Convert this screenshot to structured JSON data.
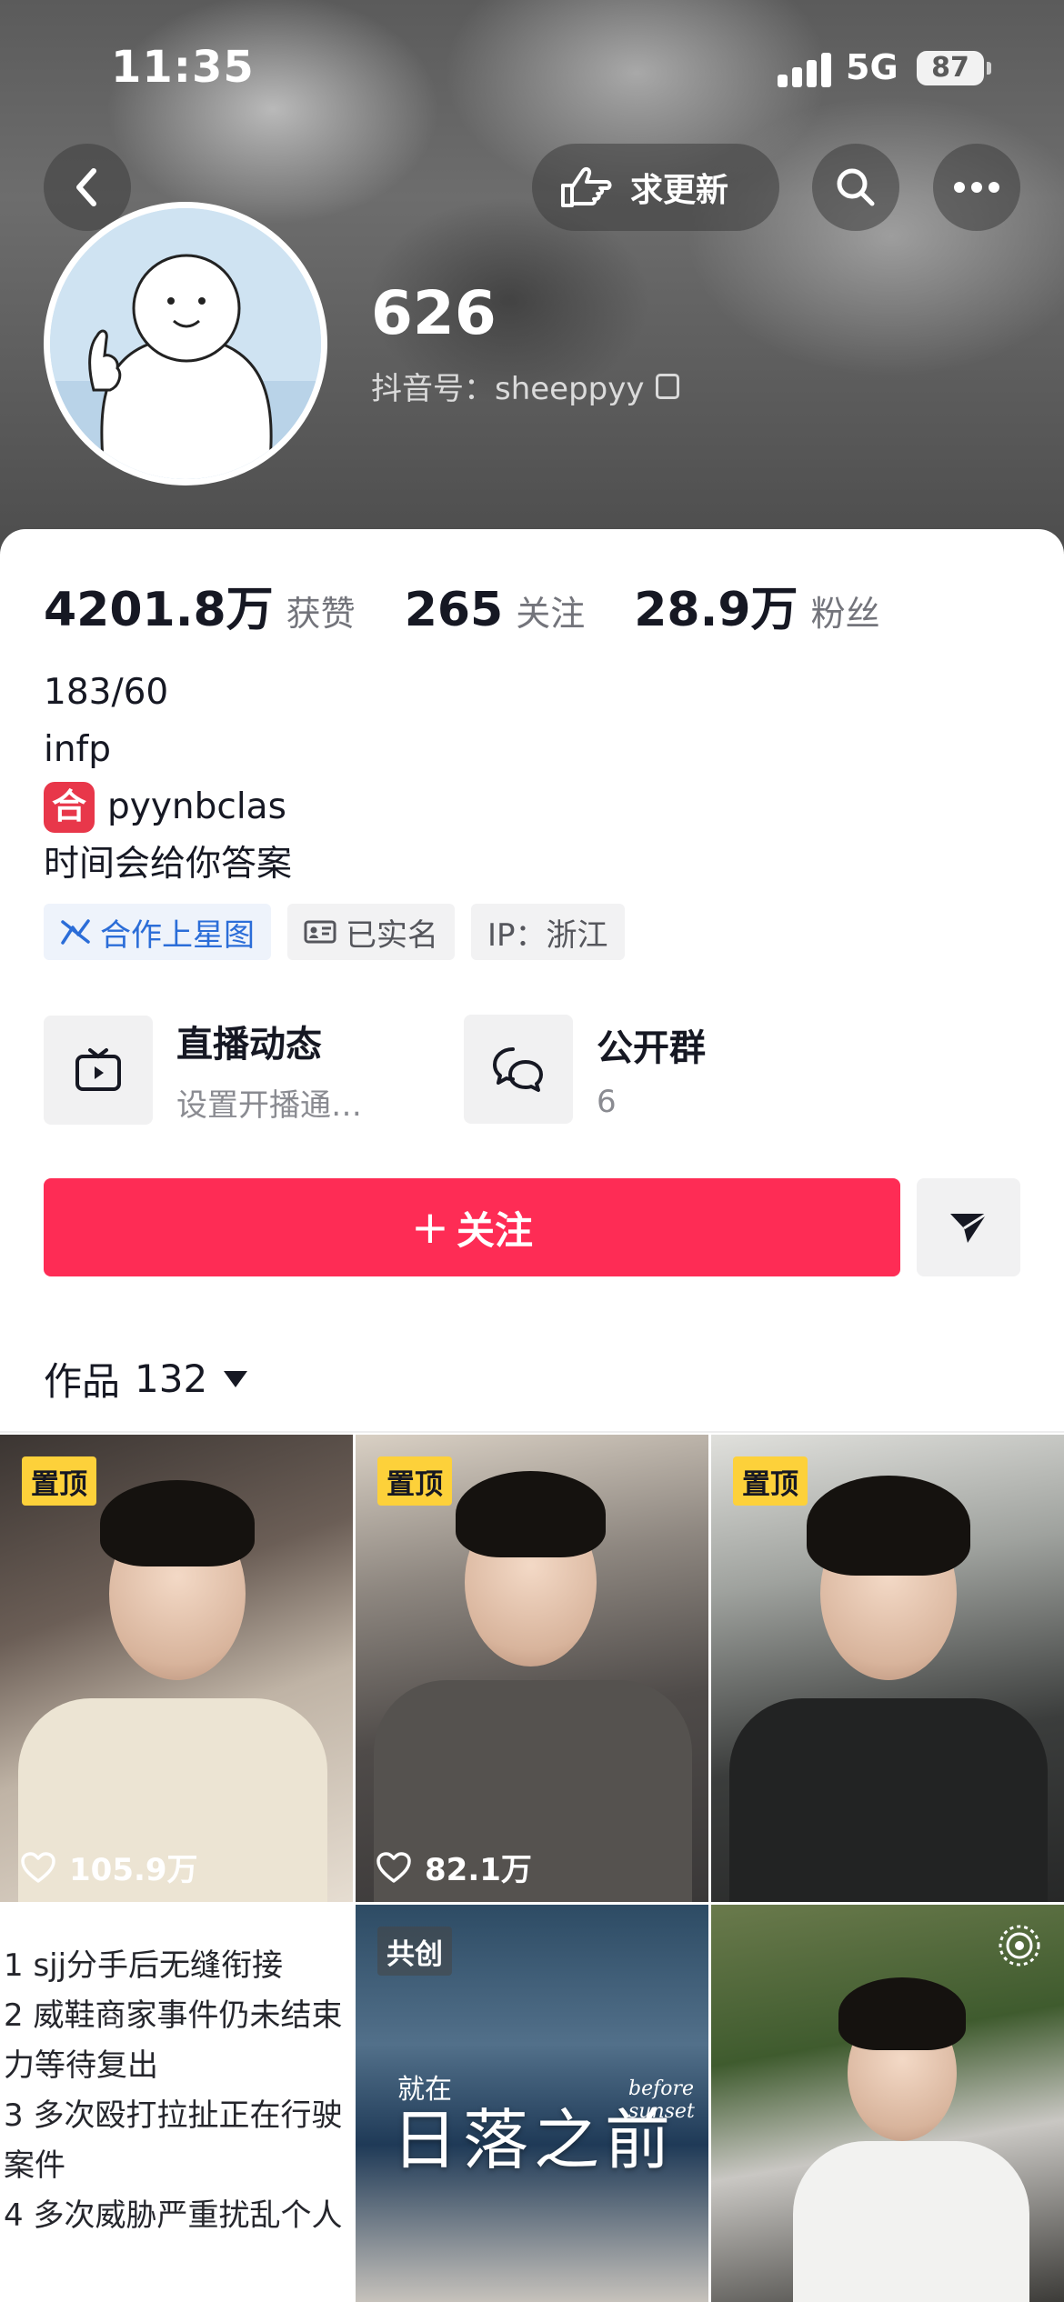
{
  "status_bar": {
    "time": "11:35",
    "network": "5G",
    "battery": "87"
  },
  "header": {
    "update_label": "求更新"
  },
  "profile": {
    "nickname": "626",
    "douyin_id": "抖音号：sheeppyy",
    "stats": [
      {
        "value": "4201.8万",
        "label": "获赞"
      },
      {
        "value": "265",
        "label": "关注"
      },
      {
        "value": "28.9万",
        "label": "粉丝"
      }
    ],
    "bio": [
      "183/60",
      "infp",
      "pyynbclas",
      "时间会给你答案"
    ],
    "bio_badge": "合",
    "tags": [
      "合作上星图",
      "已实名",
      "IP：浙江"
    ]
  },
  "features": [
    {
      "title": "直播动态",
      "subtitle": "设置开播通…"
    },
    {
      "title": "公开群",
      "subtitle": "6"
    }
  ],
  "actions": {
    "follow_label": "关注",
    "follow_plus": "+"
  },
  "works": {
    "label": "作品",
    "count": "132"
  },
  "grid": {
    "pinned_label": "置顶",
    "cocreate_label": "共创",
    "likes": [
      "105.9万",
      "82.1万"
    ],
    "text_lines": [
      "1 sjj分手后无缝衔接",
      "2 威鞋商家事件仍未结束",
      "力等待复出",
      "3 多次殴打拉扯正在行驶",
      "案件",
      "4 多次威胁严重扰乱个人"
    ],
    "sunset_small": "就在",
    "sunset_title": "日落之前",
    "sunset_en": "before sunset"
  }
}
